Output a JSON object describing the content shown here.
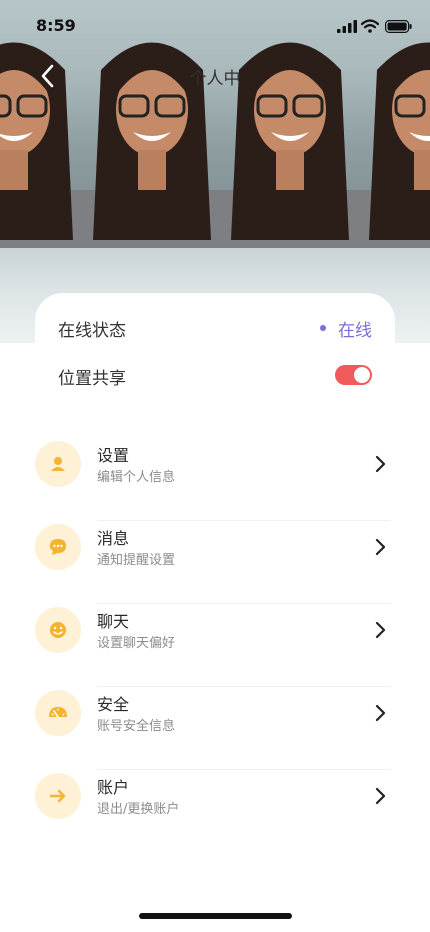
{
  "status_bar": {
    "time": "8:59"
  },
  "nav": {
    "title": "个人中",
    "back_icon": "chevron-left-icon"
  },
  "colors": {
    "accent": "#7a6fd8",
    "toggle_on": "#f05a5a",
    "icon_bg": "#fff1d6",
    "icon_fg": "#f5b330"
  },
  "settings": {
    "online": {
      "label": "在线状态",
      "value": "在线"
    },
    "location": {
      "label": "位置共享",
      "enabled": true
    }
  },
  "menu": [
    {
      "title": "设置",
      "subtitle": "编辑个人信息",
      "icon": "user-icon"
    },
    {
      "title": "消息",
      "subtitle": "通知提醒设置",
      "icon": "message-icon"
    },
    {
      "title": "聊天",
      "subtitle": "设置聊天偏好",
      "icon": "smile-icon"
    },
    {
      "title": "安全",
      "subtitle": "账号安全信息",
      "icon": "gauge-icon"
    },
    {
      "title": "账户",
      "subtitle": "退出/更换账户",
      "icon": "arrow-right-icon"
    }
  ]
}
